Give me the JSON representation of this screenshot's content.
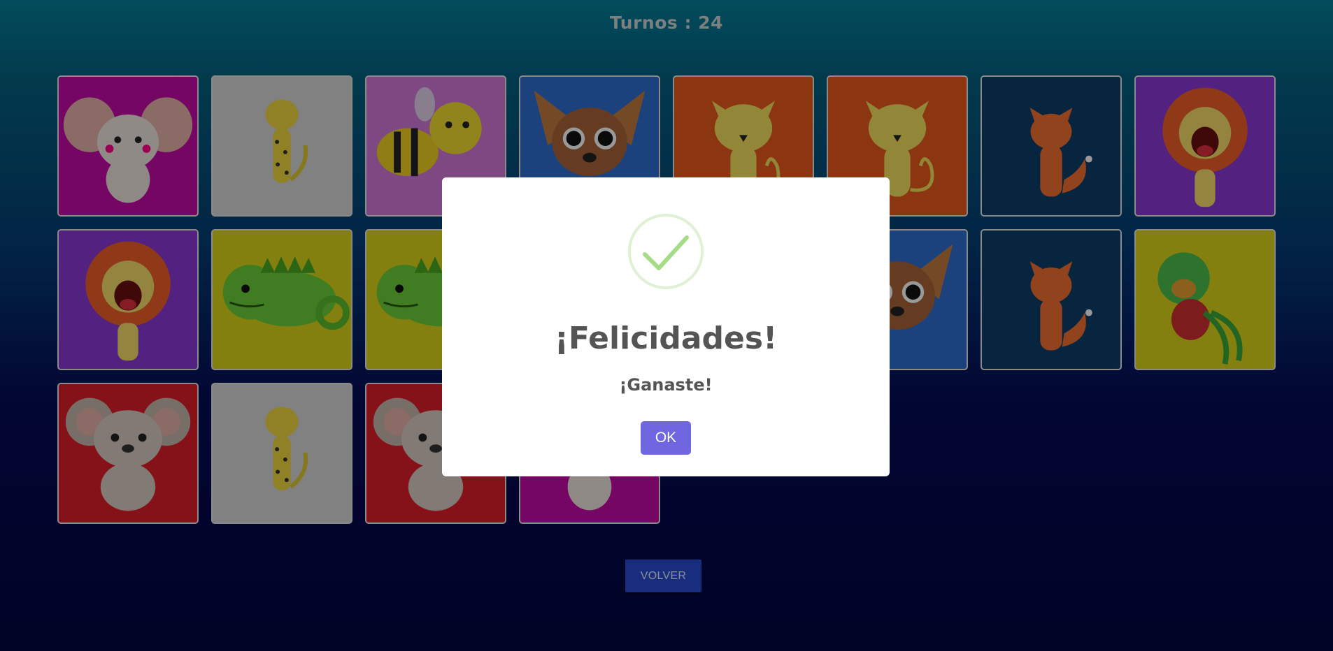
{
  "game": {
    "turns_text": "Turnos : 24",
    "back_button": "VOLVER"
  },
  "cards": [
    {
      "animal": "mouse",
      "bg": "#c40aa6",
      "row": 1,
      "col": 1
    },
    {
      "animal": "cheetah",
      "bg": "#d8d8d8",
      "row": 1,
      "col": 2
    },
    {
      "animal": "bee",
      "bg": "#d27ad9",
      "row": 1,
      "col": 3
    },
    {
      "animal": "fennec-fox",
      "bg": "#2f6fd0",
      "row": 1,
      "col": 4
    },
    {
      "animal": "cat",
      "bg": "#e85b1c",
      "row": 1,
      "col": 5
    },
    {
      "animal": "cat",
      "bg": "#e85b1c",
      "row": 1,
      "col": 6
    },
    {
      "animal": "fox",
      "bg": "#0c3f6a",
      "row": 1,
      "col": 7
    },
    {
      "animal": "lion",
      "bg": "#8b38d6",
      "row": 1,
      "col": 8
    },
    {
      "animal": "lion",
      "bg": "#8b38d6",
      "row": 2,
      "col": 1
    },
    {
      "animal": "chameleon",
      "bg": "#dcd51a",
      "row": 2,
      "col": 2
    },
    {
      "animal": "chameleon",
      "bg": "#dcd51a",
      "row": 2,
      "col": 3
    },
    {
      "animal": "fennec-fox",
      "bg": "#2f6fd0",
      "row": 2,
      "col": 6
    },
    {
      "animal": "fox",
      "bg": "#0c3f6a",
      "row": 2,
      "col": 7
    },
    {
      "animal": "parrot",
      "bg": "#dcd51a",
      "row": 2,
      "col": 8
    },
    {
      "animal": "koala",
      "bg": "#e01e2a",
      "row": 3,
      "col": 1
    },
    {
      "animal": "cheetah",
      "bg": "#d8d8d8",
      "row": 3,
      "col": 2
    },
    {
      "animal": "koala",
      "bg": "#e01e2a",
      "row": 3,
      "col": 3
    },
    {
      "animal": "mouse",
      "bg": "#c40aa6",
      "row": 3,
      "col": 4
    }
  ],
  "dialog": {
    "title": "¡Felicidades!",
    "message": "¡Ganaste!",
    "confirm_label": "OK",
    "success_color": "#a5dc86",
    "confirm_color": "#7066e0"
  }
}
